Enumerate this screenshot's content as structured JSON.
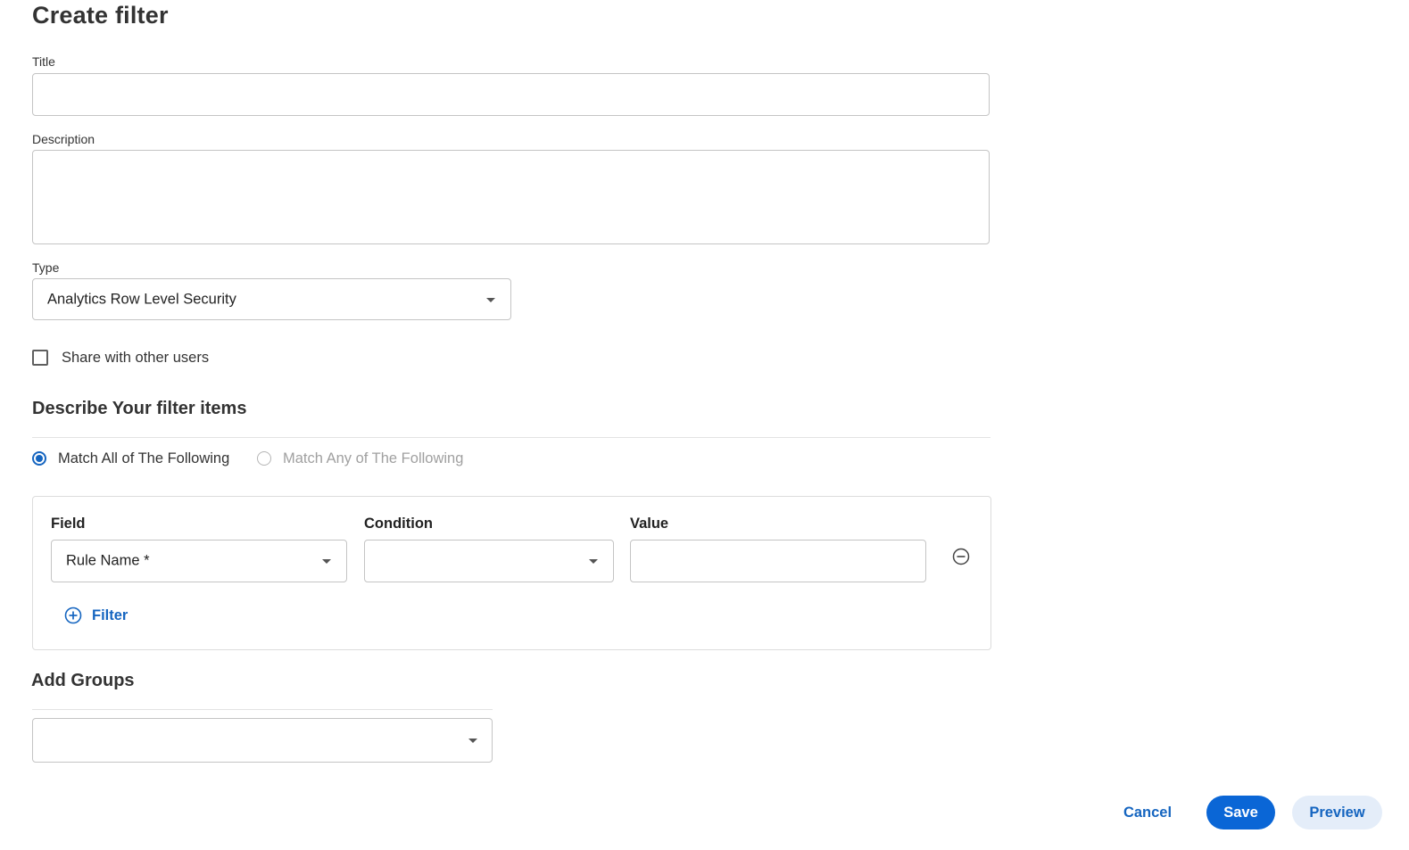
{
  "page": {
    "title": "Create filter"
  },
  "form": {
    "title_label": "Title",
    "title_value": "",
    "description_label": "Description",
    "description_value": "",
    "type_label": "Type",
    "type_value": "Analytics Row Level Security",
    "share_label": "Share with other users",
    "share_checked": false
  },
  "filter_items": {
    "heading": "Describe Your filter items",
    "match_options": [
      {
        "label": "Match All of The Following",
        "selected": true
      },
      {
        "label": "Match Any of The Following",
        "selected": false
      }
    ],
    "columns": {
      "field": "Field",
      "condition": "Condition",
      "value": "Value"
    },
    "rows": [
      {
        "field": "Rule Name *",
        "condition": "",
        "value": ""
      }
    ],
    "add_filter_label": "Filter"
  },
  "groups": {
    "heading": "Add Groups",
    "selected": ""
  },
  "actions": {
    "cancel": "Cancel",
    "save": "Save",
    "preview": "Preview"
  },
  "colors": {
    "accent": "#1565c0",
    "primary_button": "#0a66d6",
    "secondary_button_bg": "#e4edf9",
    "border": "#c4c4c4"
  }
}
